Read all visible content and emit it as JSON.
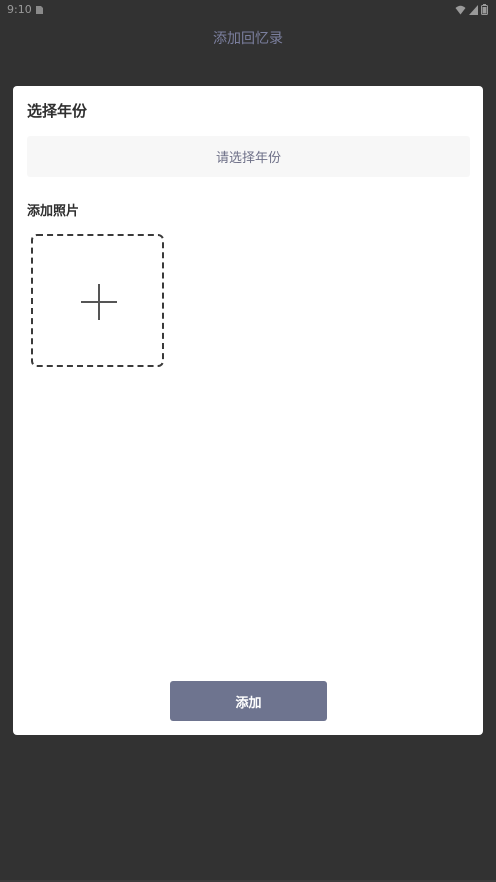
{
  "status_bar": {
    "time": "9:10",
    "left_icon": "sim-card-icon",
    "right_icons": [
      "wifi-icon",
      "signal-icon",
      "battery-icon"
    ]
  },
  "page": {
    "title": "添加回忆录"
  },
  "dialog": {
    "year_section_title": "选择年份",
    "year_select_placeholder": "请选择年份",
    "photo_section_title": "添加照片",
    "photo_add_icon": "plus-icon",
    "submit_label": "添加"
  },
  "colors": {
    "page_background": "#323232",
    "title_color": "#7b7f9e",
    "dialog_background": "#ffffff",
    "select_background": "#f7f7f7",
    "button_background": "#6e748f",
    "button_text": "#ffffff"
  }
}
